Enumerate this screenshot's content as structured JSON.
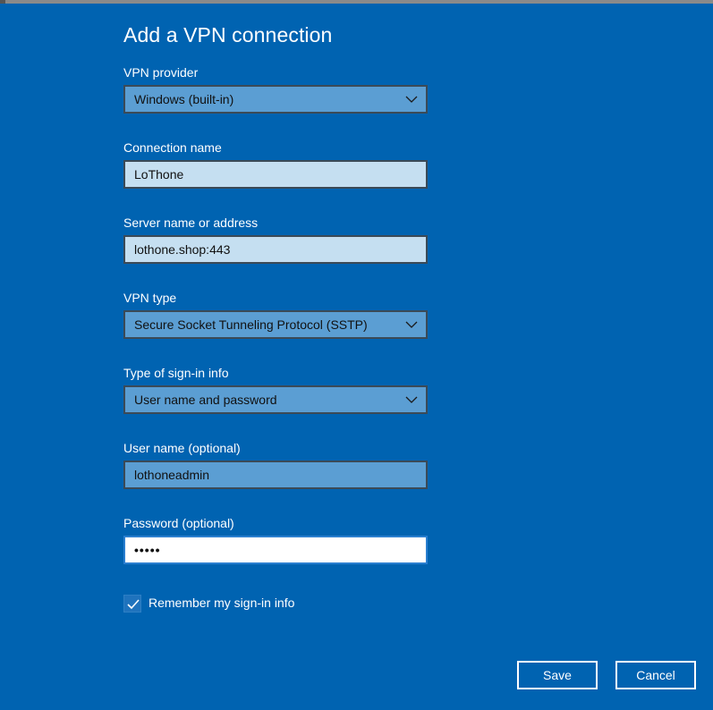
{
  "dialog": {
    "title": "Add a VPN connection"
  },
  "fields": {
    "vpn_provider": {
      "label": "VPN provider",
      "value": "Windows (built-in)"
    },
    "connection_name": {
      "label": "Connection name",
      "value": "LoThone"
    },
    "server_address": {
      "label": "Server name or address",
      "value": "lothone.shop:443"
    },
    "vpn_type": {
      "label": "VPN type",
      "value": "Secure Socket Tunneling Protocol (SSTP)"
    },
    "sign_in_type": {
      "label": "Type of sign-in info",
      "value": "User name and password"
    },
    "username": {
      "label": "User name (optional)",
      "value": "lothoneadmin"
    },
    "password": {
      "label": "Password (optional)",
      "value": "•••••"
    }
  },
  "remember": {
    "label": "Remember my sign-in info",
    "checked": true
  },
  "buttons": {
    "save": "Save",
    "cancel": "Cancel"
  },
  "icons": {
    "dropdown": "chevron-down-icon",
    "checkbox": "checkmark-icon"
  },
  "colors": {
    "background": "#0063b1",
    "select": "#5b9ed3",
    "input_light": "#c5dff1"
  }
}
